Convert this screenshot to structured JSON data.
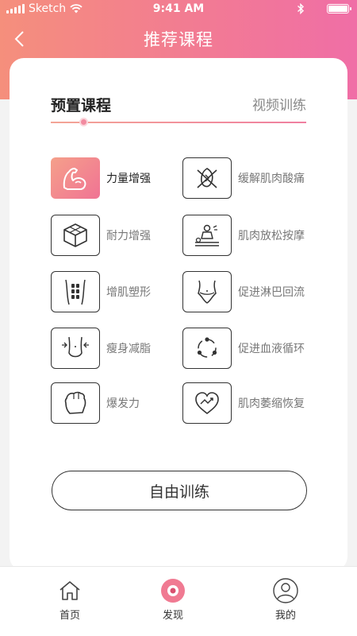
{
  "status": {
    "carrier": "Sketch",
    "time": "9:41 AM",
    "battery_level": 1.0
  },
  "nav": {
    "title": "推荐课程",
    "back_icon": "chevron-left-icon"
  },
  "tabs": {
    "preset": "预置课程",
    "video": "视频训练",
    "active": "preset"
  },
  "colors": {
    "accent_start": "#f58f7c",
    "accent_end": "#f06ea6",
    "active_tile": "#f07394"
  },
  "courses": [
    {
      "label": "力量增强",
      "icon": "flexed-arm-icon",
      "active": true
    },
    {
      "label": "缓解肌肉酸痛",
      "icon": "sore-muscle-icon",
      "active": false
    },
    {
      "label": "耐力增强",
      "icon": "cube-icon",
      "active": false
    },
    {
      "label": "肌肉放松按摩",
      "icon": "massage-icon",
      "active": false
    },
    {
      "label": "增肌塑形",
      "icon": "abs-icon",
      "active": false
    },
    {
      "label": "促进淋巴回流",
      "icon": "pelvis-icon",
      "active": false
    },
    {
      "label": "瘦身减脂",
      "icon": "waist-slim-icon",
      "active": false
    },
    {
      "label": "促进血液循环",
      "icon": "circulation-icon",
      "active": false
    },
    {
      "label": "爆发力",
      "icon": "fist-icon",
      "active": false
    },
    {
      "label": "肌肉萎缩恢复",
      "icon": "heart-recovery-icon",
      "active": false
    }
  ],
  "free_training": {
    "label": "自由训练"
  },
  "tabbar": {
    "items": [
      {
        "label": "首页",
        "icon": "home-icon"
      },
      {
        "label": "发现",
        "icon": "discover-icon"
      },
      {
        "label": "我的",
        "icon": "profile-icon"
      }
    ]
  }
}
